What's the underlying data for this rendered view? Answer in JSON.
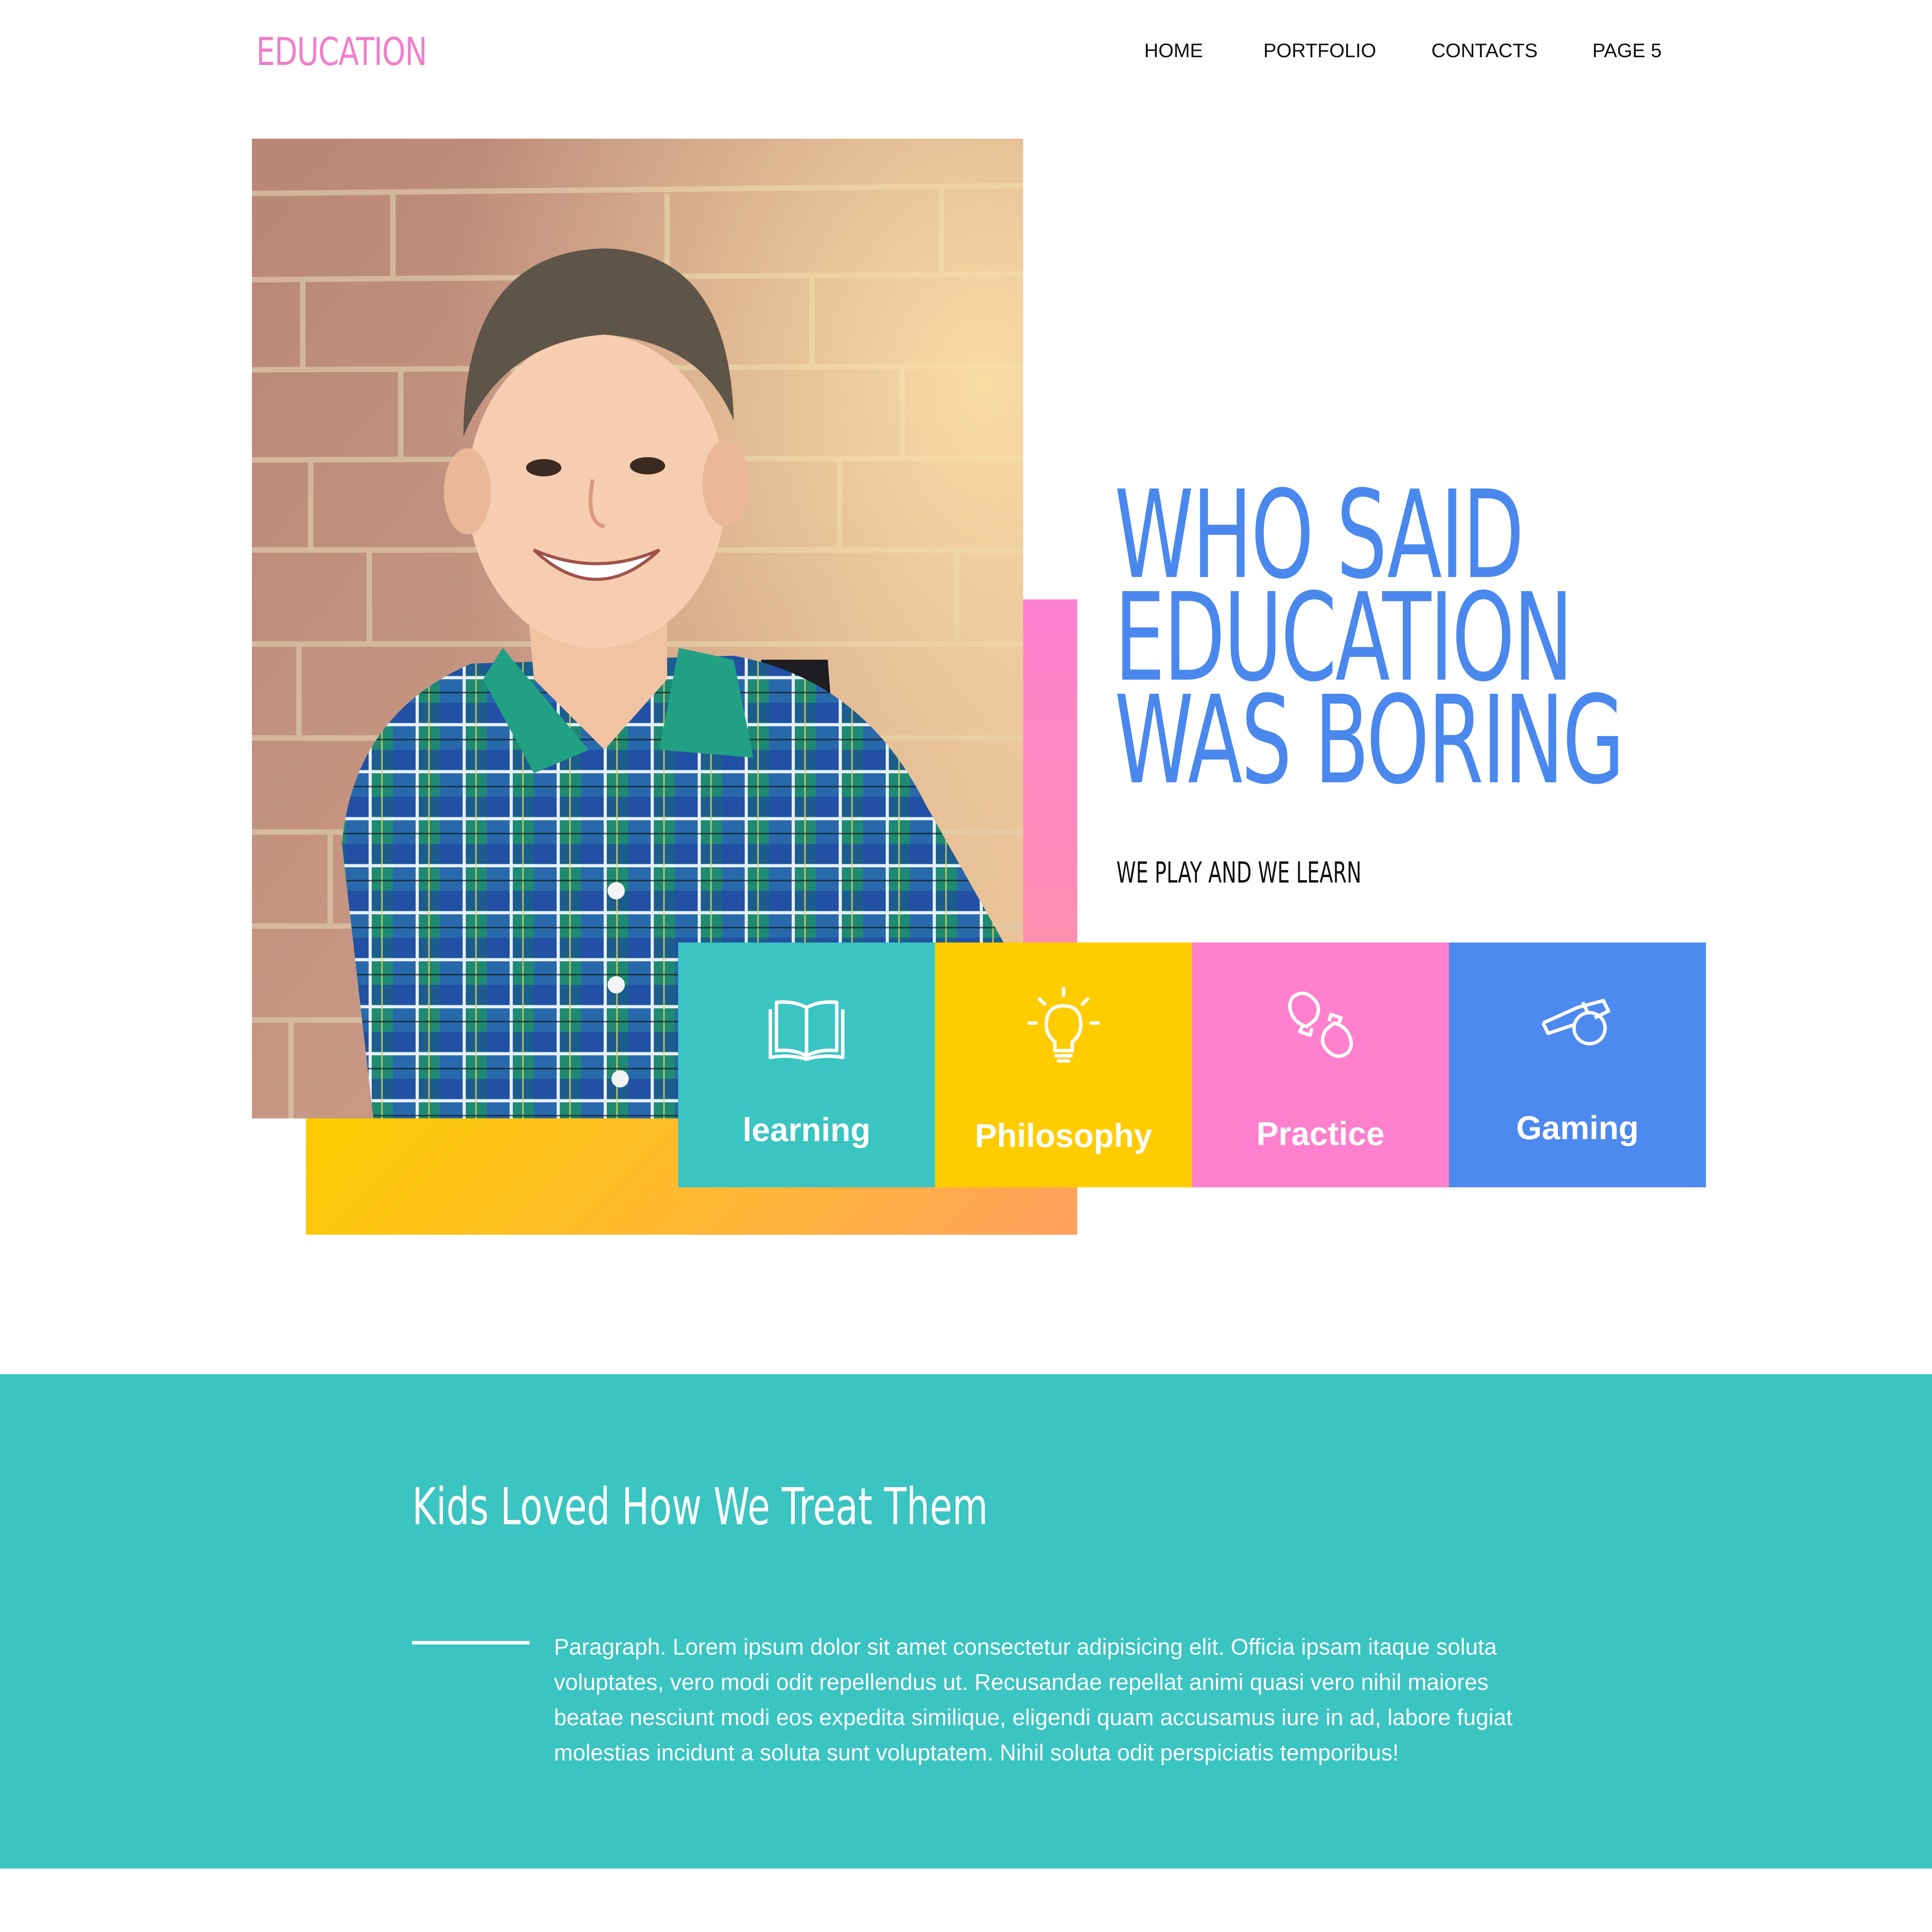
{
  "brand": {
    "logo": "EDUCATION",
    "logo_color": "#f07fcb"
  },
  "nav": {
    "items": [
      {
        "label": "HOME"
      },
      {
        "label": "PORTFOLIO"
      },
      {
        "label": "CONTACTS"
      },
      {
        "label": "PAGE 5"
      }
    ]
  },
  "hero": {
    "headline_lines": [
      "WHO SAID",
      "EDUCATION",
      "WAS BORING"
    ],
    "subheading": "WE PLAY AND WE LEARN",
    "headline_color": "#4a88ee",
    "image": "boy-with-backpack-against-brick-wall-photo"
  },
  "tiles": [
    {
      "label": "learning",
      "icon": "open-book-icon",
      "color": "#3ac4c2"
    },
    {
      "label": "Philosophy",
      "icon": "lightbulb-icon",
      "color": "#ffcc00"
    },
    {
      "label": "Practice",
      "icon": "boxing-gloves-icon",
      "color": "#ff80cc"
    },
    {
      "label": "Gaming",
      "icon": "whistle-icon",
      "color": "#4d8af0"
    }
  ],
  "testimonial": {
    "title": "Kids Loved How We Treat Them",
    "paragraph": "Paragraph. Lorem ipsum dolor sit amet consectetur adipisicing elit. Officia ipsam itaque soluta voluptates, vero modi odit repellendus ut. Recusandae repellat animi quasi vero nihil maiores beatae nesciunt modi eos expedita similique, eligendi quam accusamus iure in ad, labore fugiat molestias incidunt a soluta sunt voluptatem. Nihil soluta odit perspiciatis temporibus!",
    "background": "#3ac4c2"
  }
}
